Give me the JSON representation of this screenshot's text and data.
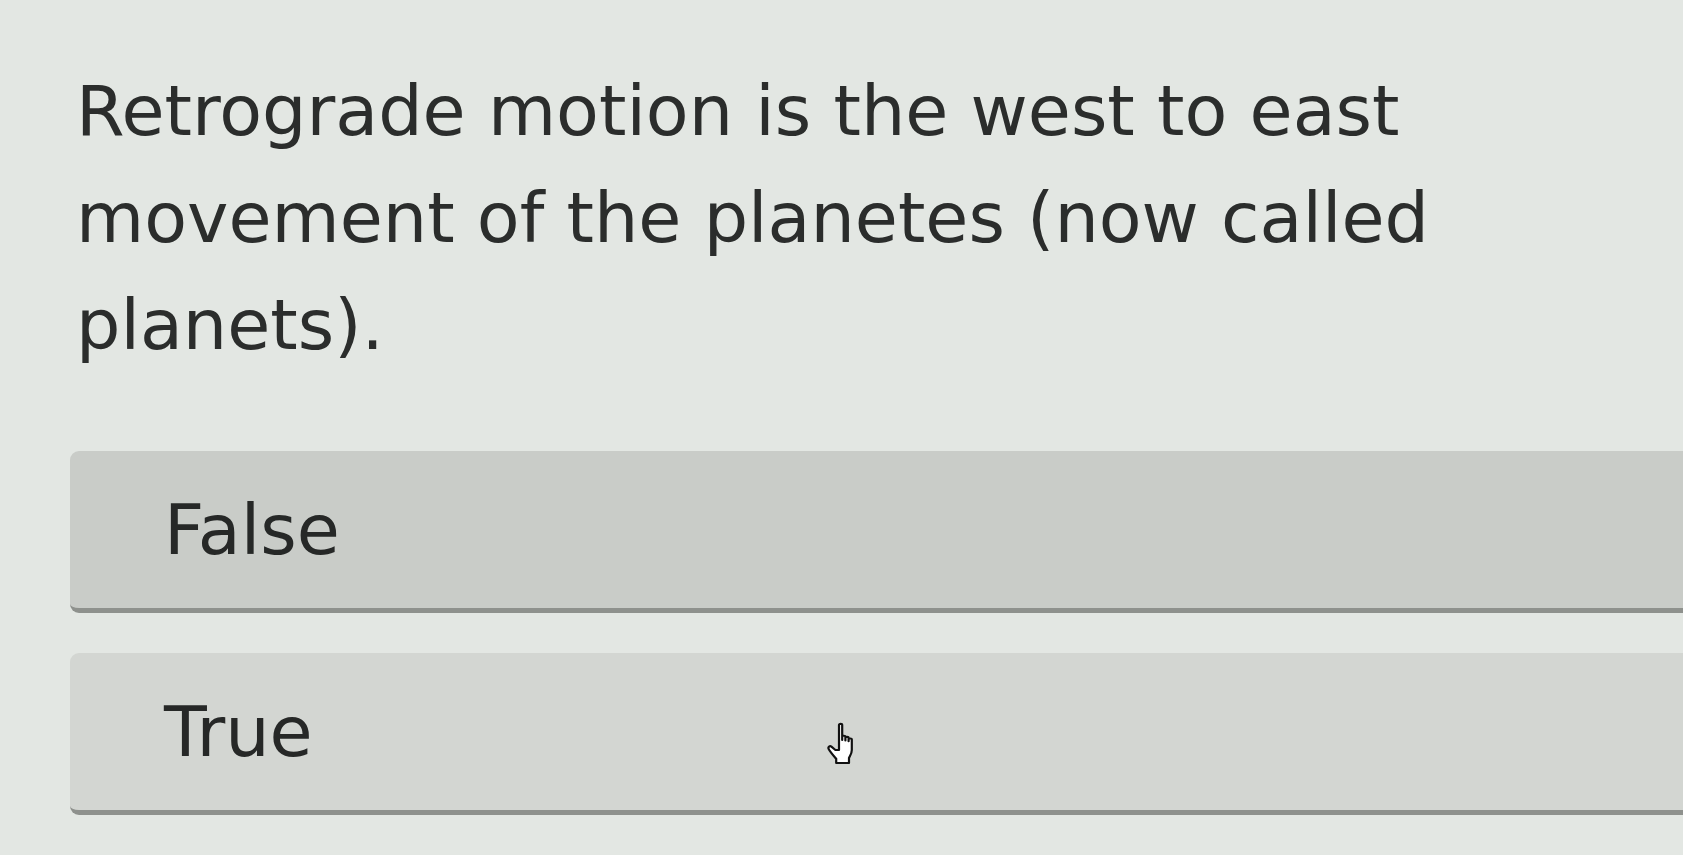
{
  "question": {
    "text": "Retrograde motion is the west to east movement of the planetes (now called planets)."
  },
  "options": [
    {
      "label": "False",
      "hovered": false
    },
    {
      "label": "True",
      "hovered": true
    }
  ]
}
